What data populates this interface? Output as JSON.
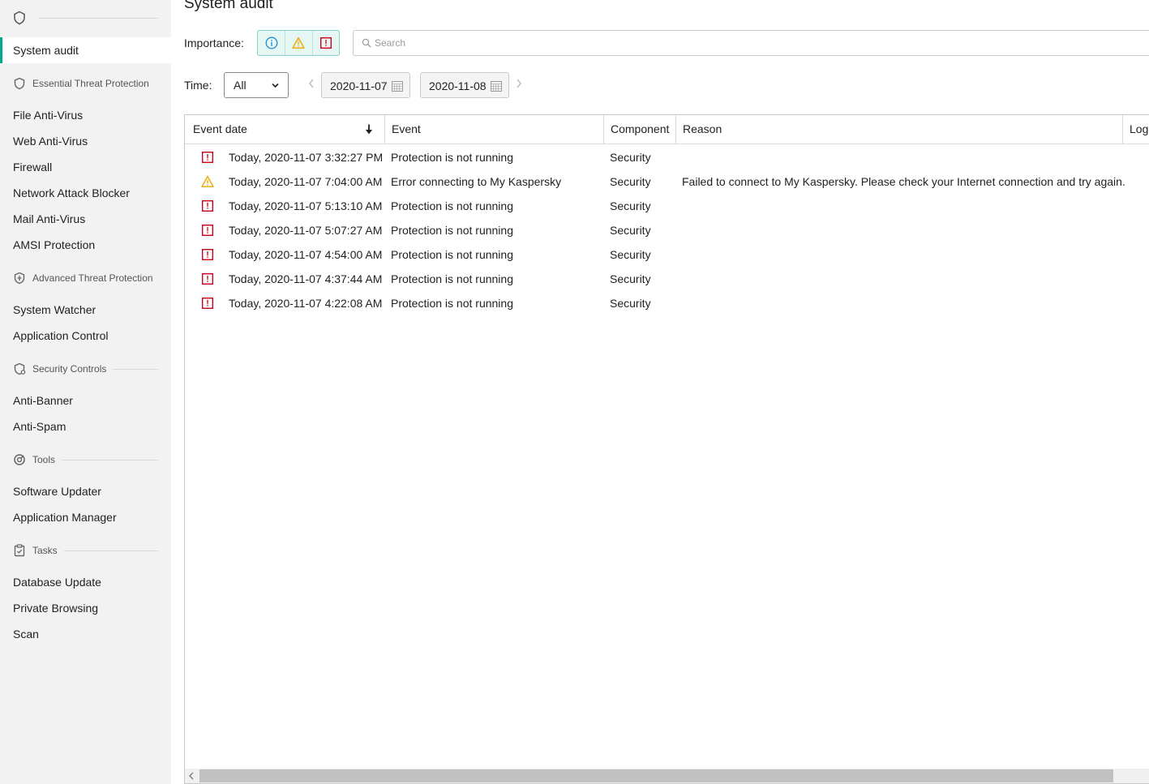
{
  "page": {
    "title": "System audit"
  },
  "sidebar": {
    "items_top": [
      {
        "label": "System audit",
        "active": true
      }
    ],
    "sections": [
      {
        "title": "Essential Threat Protection",
        "icon": "shield-icon",
        "items": [
          "File Anti-Virus",
          "Web Anti-Virus",
          "Firewall",
          "Network Attack Blocker",
          "Mail Anti-Virus",
          "AMSI Protection"
        ]
      },
      {
        "title": "Advanced Threat Protection",
        "icon": "shield-plus-icon",
        "items": [
          "System Watcher",
          "Application Control"
        ]
      },
      {
        "title": "Security Controls",
        "icon": "shield-half-icon",
        "items": [
          "Anti-Banner",
          "Anti-Spam"
        ]
      },
      {
        "title": "Tools",
        "icon": "tools-icon",
        "items": [
          "Software Updater",
          "Application Manager"
        ]
      },
      {
        "title": "Tasks",
        "icon": "tasks-icon",
        "items": [
          "Database Update",
          "Private Browsing",
          "Scan"
        ]
      }
    ]
  },
  "filters": {
    "importance_label": "Importance:",
    "importance_buttons": [
      "info-icon",
      "warning-icon",
      "critical-icon"
    ],
    "search_placeholder": "Search",
    "time_label": "Time:",
    "time_value": "All",
    "date_from": "2020-11-07",
    "date_to": "2020-11-08"
  },
  "table": {
    "columns": [
      "Event date",
      "Event",
      "Component",
      "Reason",
      "Log"
    ],
    "sort": {
      "column": "Event date",
      "direction": "descending"
    },
    "rows": [
      {
        "severity": "critical",
        "date": "Today, 2020-11-07 3:32:27 PM",
        "event": "Protection is not running",
        "component": "Security",
        "reason": ""
      },
      {
        "severity": "warning",
        "date": "Today, 2020-11-07 7:04:00 AM",
        "event": "Error connecting to My Kaspersky",
        "component": "Security",
        "reason": "Failed to connect to My Kaspersky. Please check your Internet connection and try again."
      },
      {
        "severity": "critical",
        "date": "Today, 2020-11-07 5:13:10 AM",
        "event": "Protection is not running",
        "component": "Security",
        "reason": ""
      },
      {
        "severity": "critical",
        "date": "Today, 2020-11-07 5:07:27 AM",
        "event": "Protection is not running",
        "component": "Security",
        "reason": ""
      },
      {
        "severity": "critical",
        "date": "Today, 2020-11-07 4:54:00 AM",
        "event": "Protection is not running",
        "component": "Security",
        "reason": ""
      },
      {
        "severity": "critical",
        "date": "Today, 2020-11-07 4:37:44 AM",
        "event": "Protection is not running",
        "component": "Security",
        "reason": ""
      },
      {
        "severity": "critical",
        "date": "Today, 2020-11-07 4:22:08 AM",
        "event": "Protection is not running",
        "component": "Security",
        "reason": ""
      }
    ]
  },
  "colors": {
    "accent": "#00a88e",
    "critical": "#d0021b",
    "warning": "#e8a800",
    "info": "#1f8fd6"
  }
}
